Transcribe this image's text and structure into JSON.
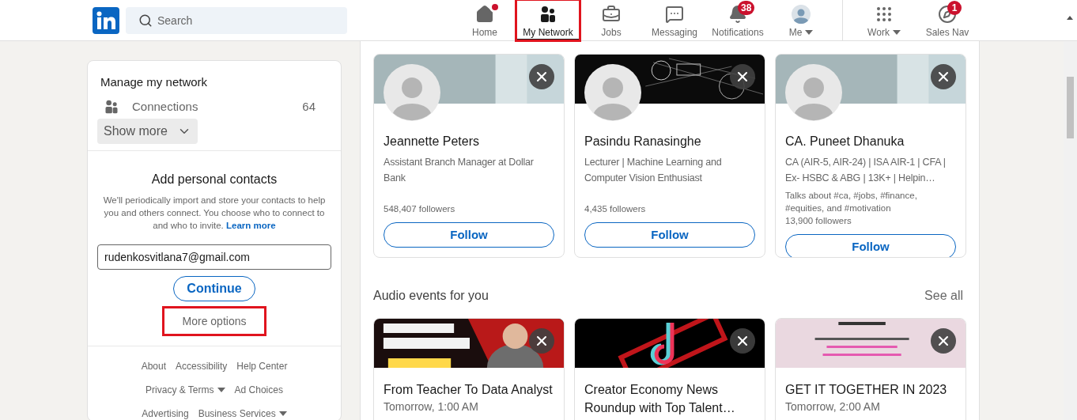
{
  "nav": {
    "search": {
      "placeholder": "Search"
    },
    "items": [
      {
        "label": "Home",
        "badge_dot": true,
        "selected": false,
        "highlighted": false
      },
      {
        "label": "My Network",
        "selected": true,
        "highlighted": true
      },
      {
        "label": "Jobs",
        "selected": false,
        "highlighted": false
      },
      {
        "label": "Messaging",
        "selected": false,
        "highlighted": false
      },
      {
        "label": "Notifications",
        "badge": "38",
        "selected": false,
        "highlighted": false
      },
      {
        "label": "Me",
        "dropdown": true,
        "selected": false,
        "highlighted": false
      },
      {
        "label": "Work",
        "dropdown": true,
        "divider_before": true,
        "selected": false,
        "highlighted": false
      },
      {
        "label": "Sales Nav",
        "badge": "1",
        "selected": false,
        "highlighted": false
      }
    ]
  },
  "sidebar": {
    "title": "Manage my network",
    "connections": {
      "label": "Connections",
      "count": "64"
    },
    "show_more": "Show more",
    "contacts": {
      "title": "Add personal contacts",
      "text": "We'll periodically import and store your contacts to help you and others connect. You choose who to connect to and who to invite.",
      "link": "Learn more",
      "email": "rudenkosvitlana7@gmail.com",
      "continue": "Continue",
      "more_options": {
        "label": "More options",
        "highlighted": true
      }
    },
    "footer": [
      {
        "label": "About",
        "dropdown": false
      },
      {
        "label": "Accessibility",
        "dropdown": false
      },
      {
        "label": "Help Center",
        "dropdown": false
      },
      {
        "label": "Privacy & Terms",
        "dropdown": true
      },
      {
        "label": "Ad Choices",
        "dropdown": false
      },
      {
        "label": "Advertising",
        "dropdown": false
      },
      {
        "label": "Business Services",
        "dropdown": true
      }
    ]
  },
  "people": [
    {
      "name": "Jeannette Peters",
      "headline": "Assistant Branch Manager at Dollar Bank",
      "followers": "548,407 followers",
      "button": "Follow"
    },
    {
      "name": "Pasindu Ranasinghe",
      "headline": "Lecturer | Machine Learning and Computer Vision Enthusiast",
      "followers": "4,435 followers",
      "button": "Follow"
    },
    {
      "name": "CA. Puneet Dhanuka",
      "headline": "CA (AIR-5, AIR-24) | ISA AIR-1 | CFA | Ex- HSBC & ABG | 13K+ | Helpin…",
      "topics": "Talks about #ca, #jobs, #finance, #equities, and #motivation",
      "followers": "13,900 followers",
      "button": "Follow"
    }
  ],
  "audio_events": {
    "title": "Audio events for you",
    "see_all": "See all",
    "events": [
      {
        "title": "From Teacher To Data Analyst",
        "time": "Tomorrow, 1:00 AM"
      },
      {
        "title": "Creator Economy News Roundup with Top Talent…"
      },
      {
        "title": "GET IT TOGETHER IN 2023",
        "time": "Tomorrow, 2:00 AM"
      }
    ]
  }
}
